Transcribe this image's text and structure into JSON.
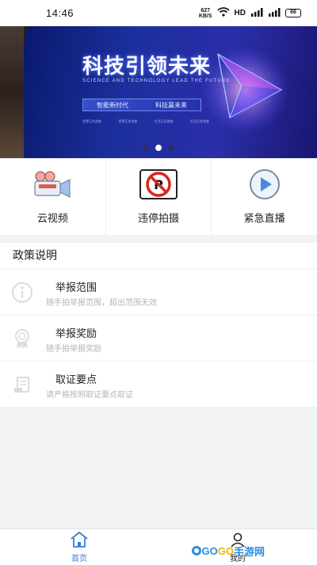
{
  "status": {
    "time": "14:46",
    "net_speed_value": "627",
    "net_speed_unit": "KB/S",
    "hd": "HD",
    "battery": "66"
  },
  "banner": {
    "title": "科技引领未来",
    "subtitle": "SCIENCE AND TECHNOLOGY LEAD THE FUTURE",
    "bar_left": "智能新时代",
    "bar_right": "科技赢未来",
    "tags": [
      "世界正在改变",
      "世界正在改变",
      "生活正在改变",
      "生活正在改变"
    ],
    "dots": 3,
    "active_dot": 1
  },
  "quick_actions": [
    {
      "label": "云视频",
      "icon": "camera-icon"
    },
    {
      "label": "违停拍摄",
      "icon": "no-parking-icon"
    },
    {
      "label": "紧急直播",
      "icon": "play-icon"
    }
  ],
  "policy": {
    "heading": "政策说明",
    "items": [
      {
        "title": "举报范围",
        "desc": "随手拍举报范围，超出范围无效",
        "icon": "info-icon"
      },
      {
        "title": "举报奖励",
        "desc": "随手拍举报奖励",
        "icon": "award-icon"
      },
      {
        "title": "取证要点",
        "desc": "请严格按照取证要点取证",
        "icon": "document-icon"
      }
    ]
  },
  "tabbar": {
    "home_label": "首页",
    "me_label": "我的"
  },
  "watermark": {
    "go1": "GO",
    "go2": "GO",
    "text": "手游网"
  },
  "colors": {
    "accent": "#3b7dd8",
    "banner_blue": "#1d2f9e",
    "no_parking_red": "#d9261c"
  }
}
